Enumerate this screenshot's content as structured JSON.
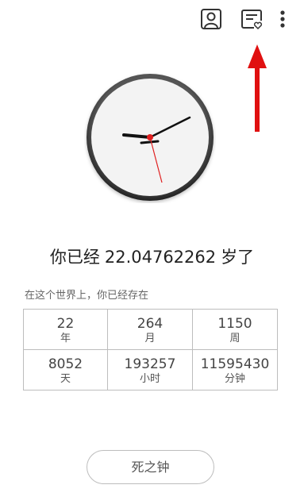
{
  "toolbar": {
    "profile_icon": "person-icon",
    "notes_icon": "card-heart-icon",
    "more_icon": "more-vertical-icon"
  },
  "clock": {
    "face_color": "#f3f3f3",
    "rim_color": "#333333",
    "second_hand_color": "#e02020"
  },
  "age": {
    "prefix": "你已经",
    "value": "22.04762262",
    "suffix": "岁了"
  },
  "subtitle": "在这个世界上，你已经存在",
  "stats": [
    {
      "value": "22",
      "unit": "年"
    },
    {
      "value": "264",
      "unit": "月"
    },
    {
      "value": "1150",
      "unit": "周"
    },
    {
      "value": "8052",
      "unit": "天"
    },
    {
      "value": "193257",
      "unit": "小时"
    },
    {
      "value": "11595430",
      "unit": "分钟"
    }
  ],
  "death_button_label": "死之钟",
  "annotation_color": "#e01010"
}
